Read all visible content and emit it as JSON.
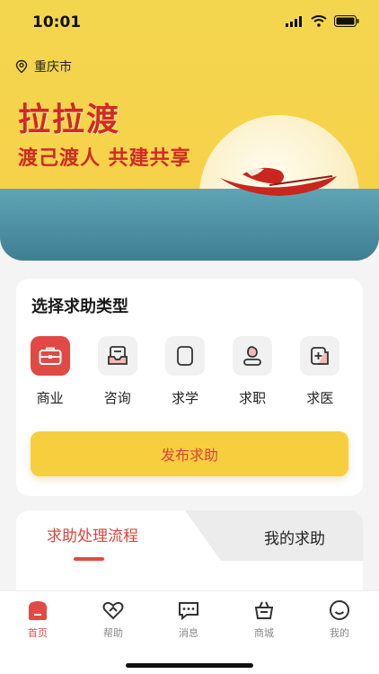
{
  "status": {
    "time": "10:01"
  },
  "header": {
    "location": "重庆市",
    "app_title": "拉拉渡",
    "slogan": "渡己渡人 共建共享"
  },
  "help_types": {
    "title": "选择求助类型",
    "items": [
      {
        "label": "商业",
        "icon": "briefcase-icon",
        "active": true
      },
      {
        "label": "咨询",
        "icon": "inbox-icon",
        "active": false
      },
      {
        "label": "求学",
        "icon": "book-icon",
        "active": false
      },
      {
        "label": "求职",
        "icon": "user-badge-icon",
        "active": false
      },
      {
        "label": "求医",
        "icon": "medical-cross-icon",
        "active": false
      }
    ],
    "publish_button": "发布求助"
  },
  "tabs": {
    "left": "求助处理流程",
    "right": "我的求助"
  },
  "tabbar": {
    "items": [
      {
        "label": "首页",
        "icon": "home-icon",
        "active": true
      },
      {
        "label": "帮助",
        "icon": "heart-hand-icon",
        "active": false
      },
      {
        "label": "消息",
        "icon": "message-icon",
        "active": false
      },
      {
        "label": "商城",
        "icon": "shop-basket-icon",
        "active": false
      },
      {
        "label": "我的",
        "icon": "smile-face-icon",
        "active": false
      }
    ]
  },
  "colors": {
    "accent": "#e14a44",
    "brand_yellow": "#f7cf3e",
    "sea": "#4f8fa3"
  }
}
